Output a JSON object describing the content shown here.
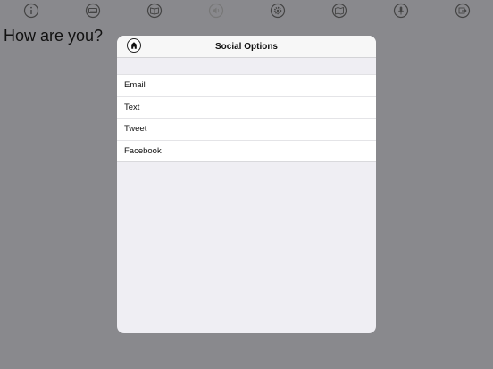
{
  "toolbar": {
    "buttons": [
      {
        "name": "info-icon"
      },
      {
        "name": "keyboard-icon"
      },
      {
        "name": "book-icon"
      },
      {
        "name": "speaker-icon"
      },
      {
        "name": "gear-icon"
      },
      {
        "name": "map-icon"
      },
      {
        "name": "microphone-icon"
      },
      {
        "name": "share-icon"
      }
    ]
  },
  "editor": {
    "text": "How are you?"
  },
  "modal": {
    "title": "Social Options",
    "home_icon": "home-icon",
    "items": [
      "Email",
      "Text",
      "Tweet",
      "Facebook"
    ]
  },
  "colors": {
    "background": "#89898d",
    "panel": "#efeef3",
    "row": "#ffffff"
  }
}
